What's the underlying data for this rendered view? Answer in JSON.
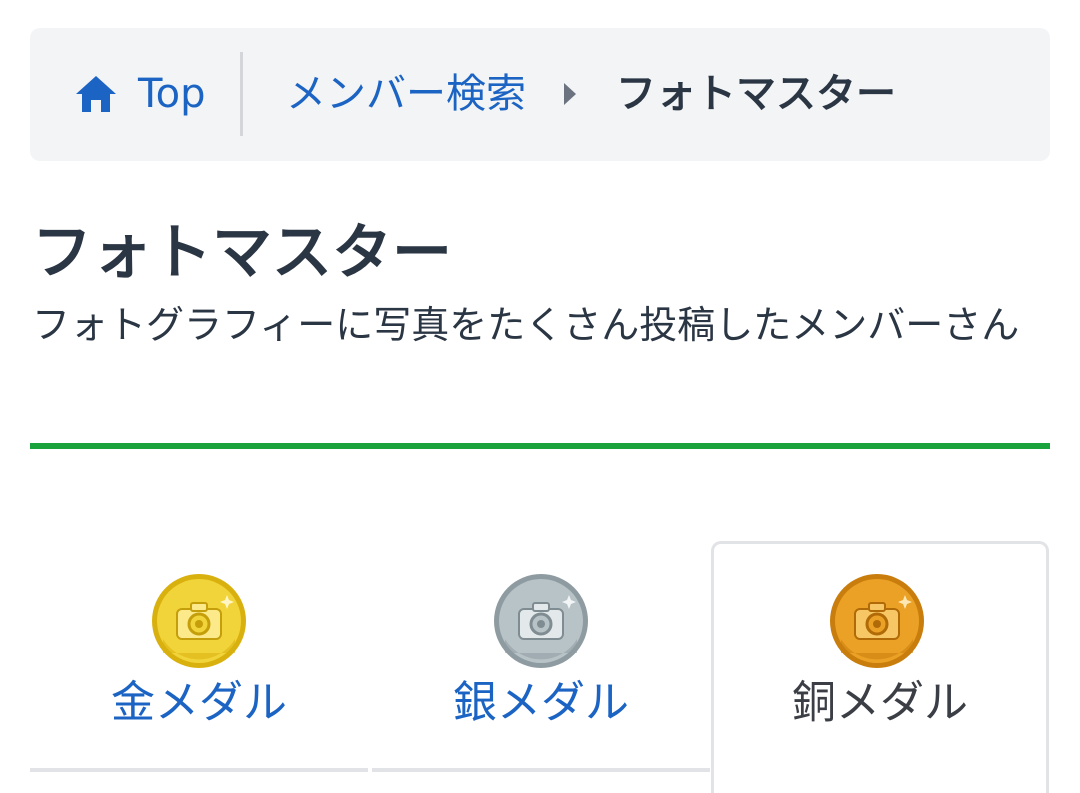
{
  "breadcrumb": {
    "home_label": "Top",
    "link_label": "メンバー検索",
    "current_label": "フォトマスター"
  },
  "header": {
    "title": "フォトマスター",
    "description": "フォトグラフィーに写真をたくさん投稿したメンバーさん"
  },
  "tabs": [
    {
      "label": "金メダル",
      "medal": "gold-medal-camera-icon",
      "active": false
    },
    {
      "label": "銀メダル",
      "medal": "silver-medal-camera-icon",
      "active": false
    },
    {
      "label": "銅メダル",
      "medal": "bronze-medal-camera-icon",
      "active": true
    }
  ],
  "colors": {
    "link": "#1c64c4",
    "text": "#2b3644",
    "accent_rule": "#1aa23d",
    "breadcrumb_bg": "#f3f4f5",
    "gold": "#e6c21e",
    "silver": "#a7b3b8",
    "bronze": "#e0961a"
  }
}
